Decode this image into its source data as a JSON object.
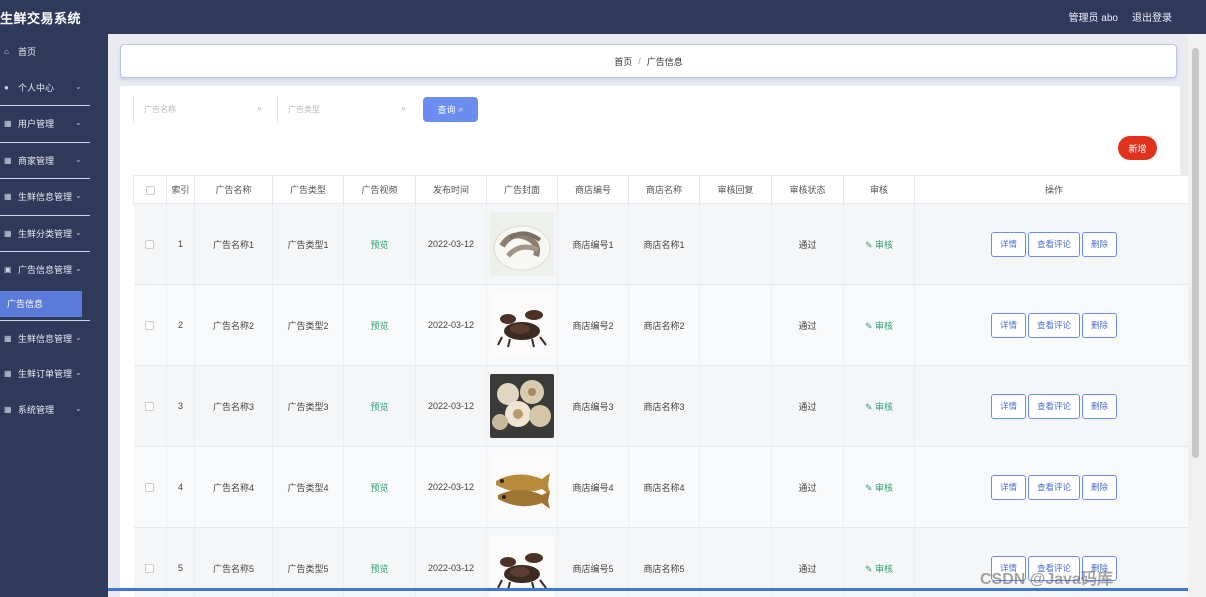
{
  "app": {
    "title": "生鲜交易系统"
  },
  "header": {
    "user_label": "管理员 abo",
    "logout_label": "退出登录"
  },
  "sidebar": {
    "items": [
      {
        "label": "首页",
        "icon": "home-icon",
        "has_children": false
      },
      {
        "label": "个人中心",
        "icon": "user-icon",
        "has_children": true
      },
      {
        "label": "用户管理",
        "icon": "list-icon",
        "has_children": true
      },
      {
        "label": "商家管理",
        "icon": "list-icon",
        "has_children": true
      },
      {
        "label": "生鲜信息管理",
        "icon": "list-icon",
        "has_children": true
      },
      {
        "label": "生鲜分类管理",
        "icon": "list-icon",
        "has_children": true
      },
      {
        "label": "广告信息管理",
        "icon": "lock-icon",
        "has_children": true,
        "active_child": "广告信息"
      },
      {
        "label": "生鲜信息管理",
        "icon": "list-icon",
        "has_children": true
      },
      {
        "label": "生鲜订单管理",
        "icon": "list-icon",
        "has_children": true
      },
      {
        "label": "系统管理",
        "icon": "list-icon",
        "has_children": true
      }
    ]
  },
  "breadcrumb": {
    "home": "首页",
    "separator": "/",
    "current": "广告信息"
  },
  "search": {
    "name_placeholder": "广告名称",
    "type_placeholder": "广告类型",
    "query_label": "查询"
  },
  "actions": {
    "add_label": "新增"
  },
  "table": {
    "headers": [
      "",
      "索引",
      "广告名称",
      "广告类型",
      "广告视频",
      "发布时间",
      "广告封面",
      "商店编号",
      "商店名称",
      "审核回复",
      "审核状态",
      "审核",
      "操作"
    ],
    "rows": [
      {
        "index": "1",
        "name": "广告名称1",
        "type": "广告类型1",
        "video": "预览",
        "date": "2022-03-12",
        "image": "shrimp",
        "shop_no": "商店编号1",
        "shop_name": "商店名称1",
        "reply": "",
        "status": "通过",
        "audit": "审核"
      },
      {
        "index": "2",
        "name": "广告名称2",
        "type": "广告类型2",
        "video": "预览",
        "date": "2022-03-12",
        "image": "lobster",
        "shop_no": "商店编号2",
        "shop_name": "商店名称2",
        "reply": "",
        "status": "通过",
        "audit": "审核"
      },
      {
        "index": "3",
        "name": "广告名称3",
        "type": "广告类型3",
        "video": "预览",
        "date": "2022-03-12",
        "image": "clams",
        "shop_no": "商店编号3",
        "shop_name": "商店名称3",
        "reply": "",
        "status": "通过",
        "audit": "审核"
      },
      {
        "index": "4",
        "name": "广告名称4",
        "type": "广告类型4",
        "video": "预览",
        "date": "2022-03-12",
        "image": "fish",
        "shop_no": "商店编号4",
        "shop_name": "商店名称4",
        "reply": "",
        "status": "通过",
        "audit": "审核"
      },
      {
        "index": "5",
        "name": "广告名称5",
        "type": "广告类型5",
        "video": "预览",
        "date": "2022-03-12",
        "image": "lobster",
        "shop_no": "商店编号5",
        "shop_name": "商店名称5",
        "reply": "",
        "status": "通过",
        "audit": "审核"
      }
    ],
    "row_buttons": {
      "detail": "详情",
      "comment": "查看评论",
      "delete": "删除"
    }
  },
  "watermark": "CSDN @Java码库",
  "colors": {
    "sidebar_bg": "#2f3a5a",
    "accent": "#6b8df0",
    "active_menu": "#5b7bd8",
    "danger": "#e0321d",
    "success": "#2fa36d"
  }
}
